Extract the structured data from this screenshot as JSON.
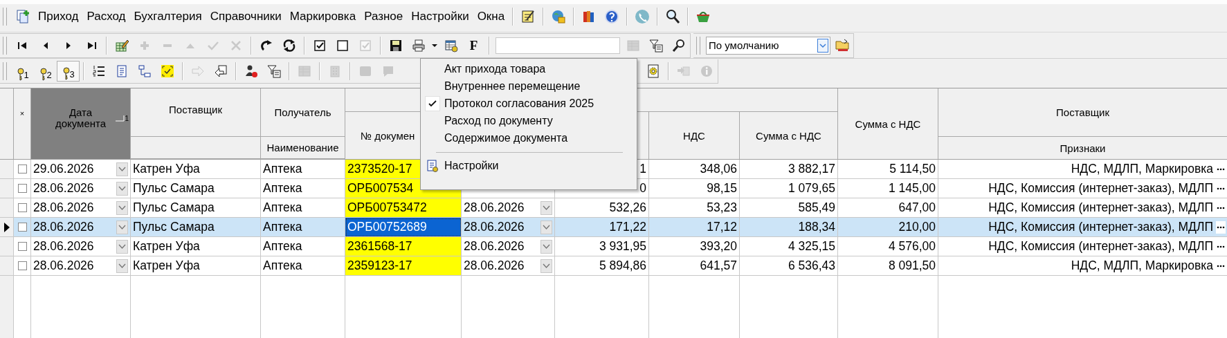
{
  "menu_bar": {
    "items": [
      "Приход",
      "Расход",
      "Бухгалтерия",
      "Справочники",
      "Маркировка",
      "Разное",
      "Настройки",
      "Окна"
    ]
  },
  "toolbar_nav": {
    "tools": [
      {
        "kind": "first",
        "disabled": false
      },
      {
        "kind": "prev",
        "disabled": false
      },
      {
        "kind": "next",
        "disabled": false
      },
      {
        "kind": "last",
        "disabled": false
      },
      {
        "kind": "sep"
      },
      {
        "kind": "edit-table",
        "disabled": false
      },
      {
        "kind": "plus",
        "disabled": true
      },
      {
        "kind": "minus",
        "disabled": true
      },
      {
        "kind": "up",
        "disabled": true
      },
      {
        "kind": "check",
        "disabled": true
      },
      {
        "kind": "cross",
        "disabled": true
      },
      {
        "kind": "sep"
      },
      {
        "kind": "redo",
        "disabled": false
      },
      {
        "kind": "refresh",
        "disabled": false
      },
      {
        "kind": "sep"
      },
      {
        "kind": "box-checked",
        "disabled": false
      },
      {
        "kind": "box-empty",
        "disabled": false
      },
      {
        "kind": "box-checked",
        "disabled": true
      },
      {
        "kind": "sep"
      },
      {
        "kind": "save",
        "disabled": false
      },
      {
        "kind": "print",
        "disabled": false
      },
      {
        "kind": "caret",
        "disabled": false
      },
      {
        "kind": "table-gear",
        "disabled": false
      },
      {
        "kind": "text",
        "label": "F",
        "disabled": false
      }
    ],
    "filter_tools": [
      {
        "kind": "grey-table",
        "disabled": true
      },
      {
        "kind": "filter-table",
        "disabled": false
      },
      {
        "kind": "magnifier",
        "disabled": false
      }
    ],
    "view_combo": {
      "value": "По умолчанию"
    }
  },
  "toolbar_tools": {
    "key_buttons": [
      {
        "label": "1",
        "selected": false
      },
      {
        "label": "2",
        "selected": false
      },
      {
        "label": "3",
        "selected": true
      }
    ],
    "tools": [
      {
        "kind": "sep"
      },
      {
        "kind": "numbered-list",
        "disabled": false
      },
      {
        "kind": "document",
        "disabled": false
      },
      {
        "kind": "tree",
        "disabled": false
      },
      {
        "kind": "yellow-check",
        "disabled": false
      },
      {
        "kind": "sep"
      },
      {
        "kind": "arrow-right",
        "disabled": true
      },
      {
        "kind": "arrow-left-doc",
        "disabled": false
      },
      {
        "kind": "sep"
      },
      {
        "kind": "user-x",
        "disabled": false
      },
      {
        "kind": "filter-table",
        "disabled": false
      },
      {
        "kind": "sep"
      },
      {
        "kind": "grey-table",
        "disabled": true
      },
      {
        "kind": "sep"
      },
      {
        "kind": "building",
        "disabled": true
      },
      {
        "kind": "sep"
      },
      {
        "kind": "grey-square",
        "disabled": true
      },
      {
        "kind": "speech",
        "disabled": true
      }
    ],
    "tools_after_menu": [
      {
        "kind": "gear-doc",
        "disabled": false
      },
      {
        "kind": "sep"
      },
      {
        "kind": "arrow-doc",
        "disabled": true
      },
      {
        "kind": "info",
        "disabled": true
      }
    ]
  },
  "table": {
    "header": {
      "mark": "×",
      "date": "Дата документа",
      "sort_order": "1",
      "supplier": "Поставщик",
      "recipient": "Получатель",
      "recipient_sub": "Наименование",
      "doc_number": "№ докумен",
      "vat": "НДС",
      "sum_vat": "Сумма с НДС",
      "total_vat": "Сумма с НДС",
      "supplier_2": "Поставщик",
      "supplier_2_sub": "Признаки"
    },
    "rows": [
      {
        "selected": false,
        "checked": false,
        "date": "29.06.2026",
        "supplier": "Катрен Уфа",
        "recipient": "Аптека",
        "doc_number": "2373520-17",
        "sum": "1",
        "vat": "348,06",
        "sum_vat": "3 882,17",
        "total_vat": "5 114,50",
        "flags": "НДС, МДЛП, Маркировка"
      },
      {
        "selected": false,
        "checked": false,
        "date": "28.06.2026",
        "supplier": "Пульс Самара",
        "recipient": "Аптека",
        "doc_number": "ОРБ007534",
        "sum": "0",
        "vat": "98,15",
        "sum_vat": "1 079,65",
        "total_vat": "1 145,00",
        "flags": "НДС, Комиссия (интернет-заказ), МДЛП"
      },
      {
        "selected": false,
        "checked": false,
        "date": "28.06.2026",
        "supplier": "Пульс Самара",
        "recipient": "Аптека",
        "doc_number": "ОРБ00753472",
        "doc_date": "28.06.2026",
        "sum": "532,26",
        "vat": "53,23",
        "sum_vat": "585,49",
        "total_vat": "647,00",
        "flags": "НДС, Комиссия (интернет-заказ), МДЛП"
      },
      {
        "selected": true,
        "checked": false,
        "date": "28.06.2026",
        "supplier": "Пульс Самара",
        "recipient": "Аптека",
        "doc_number": "ОРБ00752689",
        "doc_date": "28.06.2026",
        "sum": "171,22",
        "vat": "17,12",
        "sum_vat": "188,34",
        "total_vat": "210,00",
        "flags": "НДС, Комиссия (интернет-заказ), МДЛП"
      },
      {
        "selected": false,
        "checked": false,
        "date": "28.06.2026",
        "supplier": "Катрен Уфа",
        "recipient": "Аптека",
        "doc_number": "2361568-17",
        "doc_date": "28.06.2026",
        "sum": "3 931,95",
        "vat": "393,20",
        "sum_vat": "4 325,15",
        "total_vat": "4 576,00",
        "flags": "НДС, Комиссия (интернет-заказ), МДЛП"
      },
      {
        "selected": false,
        "checked": false,
        "date": "28.06.2026",
        "supplier": "Катрен Уфа",
        "recipient": "Аптека",
        "doc_number": "2359123-17",
        "doc_date": "28.06.2026",
        "sum": "5 894,86",
        "vat": "641,57",
        "sum_vat": "6 536,43",
        "total_vat": "8 091,50",
        "flags": "НДС, МДЛП, Маркировка"
      }
    ]
  },
  "popup_menu": {
    "items": [
      {
        "label": "Акт прихода товара",
        "checked": false
      },
      {
        "label": "Внутреннее перемещение",
        "checked": false
      },
      {
        "label": "Протокол согласования 2025",
        "checked": true
      },
      {
        "label": "Расход по документу",
        "checked": false
      },
      {
        "label": "Содержимое документа",
        "checked": false
      }
    ],
    "footer_item": {
      "label": "Настройки"
    }
  }
}
